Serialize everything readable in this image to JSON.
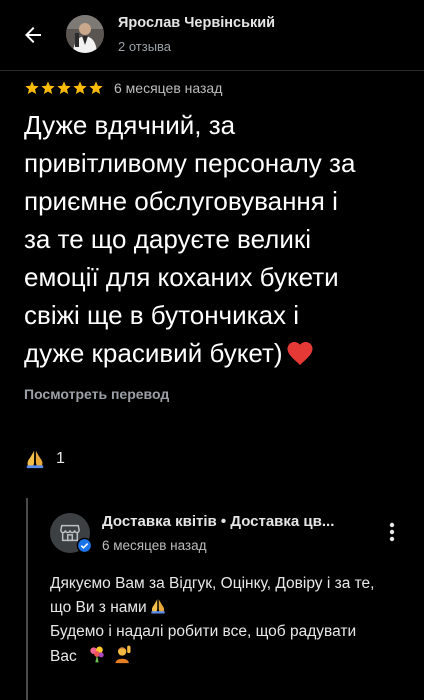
{
  "header": {
    "author_name": "Ярослав Червінський",
    "review_count": "2 отзыва"
  },
  "review": {
    "rating_stars": 5,
    "date": "6 месяцев назад",
    "text_lines": [
      "Дуже вдячний, за",
      "привітливому персоналу за",
      "приємне обслуговування і",
      "за те що даруєте великі",
      "емоції для коханих букети",
      "свіжі ще в бутончиках і",
      "дуже красивий букет)"
    ],
    "translate_label": "Посмотреть перевод",
    "reaction_count": "1"
  },
  "owner_reply": {
    "name": "Доставка квітів • Доставка цв...",
    "date": "6 месяцев назад",
    "text_lines": [
      "Дякуємо Вам за Відгук, Оцінку, Довіру і за те,",
      "що Ви з нами",
      "Будемо і надалі робити все, щоб радувати",
      "Вас"
    ]
  },
  "colors": {
    "background": "#000000",
    "star": "#fbbc04",
    "heart": "#e53935",
    "secondary_text": "#9aa0a6",
    "verified": "#1a73e8"
  },
  "icons": {
    "back": "arrow-left-icon",
    "star": "star-icon",
    "heart": "heart-icon",
    "reaction": "folded-hands-icon",
    "store": "store-icon",
    "verified": "verified-badge-icon",
    "more": "more-vertical-icon"
  }
}
